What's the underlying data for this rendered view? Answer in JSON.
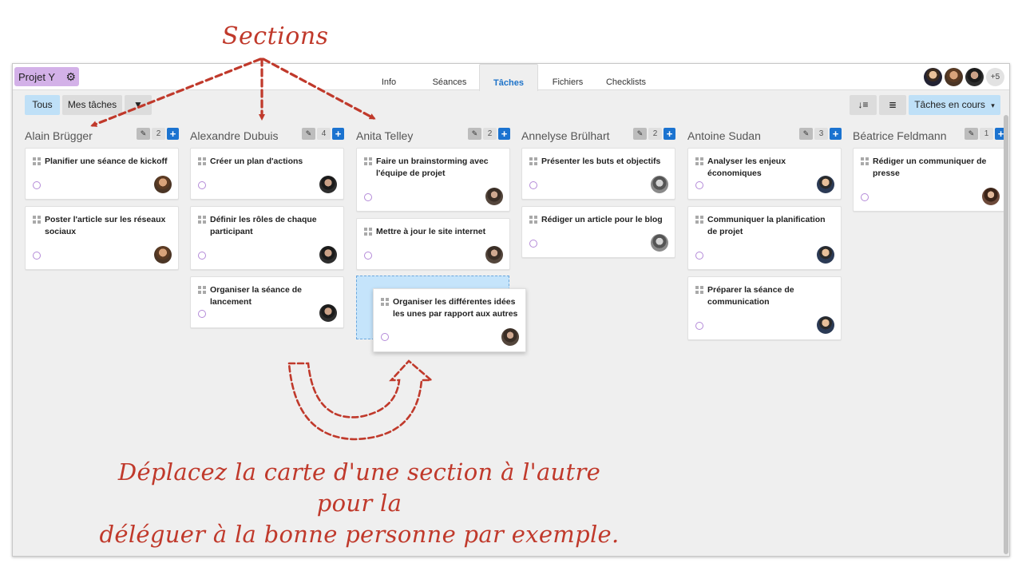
{
  "annotations": {
    "sections_label": "Sections",
    "note_line1": "Déplacez la carte d'une section à l'autre pour la",
    "note_line2": "déléguer à la bonne personne par exemple.",
    "color": "#c0392b"
  },
  "project": {
    "name": "Projet Y",
    "icon": "gear-icon",
    "color": "#d3b1e8"
  },
  "tabs": [
    {
      "label": "Info"
    },
    {
      "label": "Séances"
    },
    {
      "label": "Tâches",
      "active": true
    },
    {
      "label": "Fichiers"
    },
    {
      "label": "Checklists"
    }
  ],
  "members": {
    "more_label": "+5"
  },
  "toolbar": {
    "tous": "Tous",
    "mes_taches": "Mes tâches",
    "filter_icon": "funnel-icon",
    "sort_icon": "sort-icon",
    "list_icon": "list-icon",
    "status_filter": "Tâches en cours",
    "accent": "#bfe0f7"
  },
  "columns": [
    {
      "name": "Alain Brügger",
      "count": "2",
      "cards": [
        {
          "title": "Planifier une séance de kickoff"
        },
        {
          "title": "Poster l'article sur les réseaux sociaux"
        }
      ]
    },
    {
      "name": "Alexandre Dubuis",
      "count": "4",
      "cards": [
        {
          "title": "Créer un plan d'actions"
        },
        {
          "title": "Définir les rôles de chaque participant"
        },
        {
          "title": "Organiser la séance de lancement"
        }
      ]
    },
    {
      "name": "Anita Telley",
      "count": "2",
      "cards": [
        {
          "title": "Faire un brainstorming avec l'équipe de projet"
        },
        {
          "title": "Mettre à jour le site internet"
        }
      ],
      "dragging": {
        "title": "Organiser les différentes idées les unes par rapport aux autres"
      }
    },
    {
      "name": "Annelyse Brülhart",
      "count": "2",
      "cards": [
        {
          "title": "Présenter les buts et objectifs"
        },
        {
          "title": "Rédiger un article pour le blog"
        }
      ]
    },
    {
      "name": "Antoine Sudan",
      "count": "3",
      "cards": [
        {
          "title": "Analyser les enjeux économiques"
        },
        {
          "title": "Communiquer la planification de projet"
        },
        {
          "title": "Préparer la séance de communication"
        }
      ]
    },
    {
      "name": "Béatrice Feldmann",
      "count": "1",
      "cards": [
        {
          "title": "Rédiger un communiquer de presse"
        }
      ]
    }
  ],
  "colors": {
    "primary": "#1b73d0",
    "check_circle": "#b48ad8"
  }
}
